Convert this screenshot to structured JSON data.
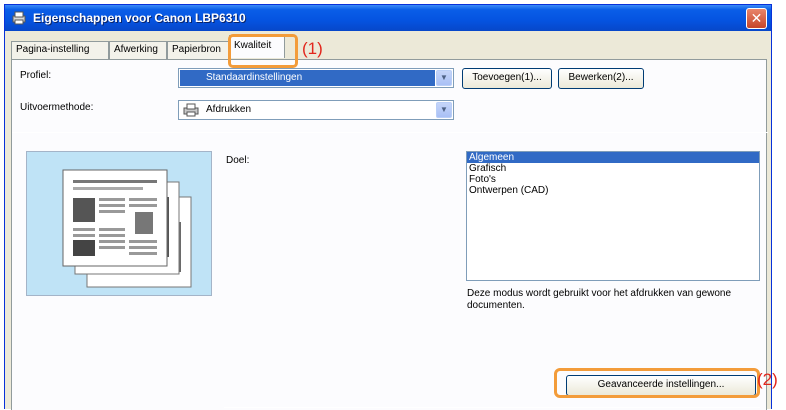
{
  "window": {
    "title": "Eigenschappen voor Canon LBP6310",
    "close_glyph": "✕",
    "title_icon": "printer-properties-icon"
  },
  "tabs": [
    {
      "label": "Pagina-instelling",
      "active": false
    },
    {
      "label": "Afwerking",
      "active": false
    },
    {
      "label": "Papierbron",
      "active": false
    },
    {
      "label": "Kwaliteit",
      "active": true
    }
  ],
  "callouts": {
    "tab": "(1)",
    "advanced": "(2)"
  },
  "profile": {
    "label": "Profiel:",
    "value": "Standaardinstellingen",
    "icon": "profile-icon",
    "add_button": "Toevoegen(1)...",
    "edit_button": "Bewerken(2)..."
  },
  "output_method": {
    "label": "Uitvoermethode:",
    "value": "Afdrukken",
    "icon": "printer-icon"
  },
  "target": {
    "label": "Doel:",
    "items": [
      "Algemeen",
      "Grafisch",
      "Foto's",
      "Ontwerpen (CAD)"
    ],
    "selected_index": 0,
    "description": "Deze modus wordt gebruikt voor het afdrukken van gewone documenten."
  },
  "advanced_button": "Geavanceerde instellingen...",
  "colors": {
    "titlebar": "#0553e0",
    "selection": "#316ac5",
    "highlight_box": "#f39c3a",
    "callout_text": "#e2261c",
    "preview_bg": "#bfe3f6"
  }
}
